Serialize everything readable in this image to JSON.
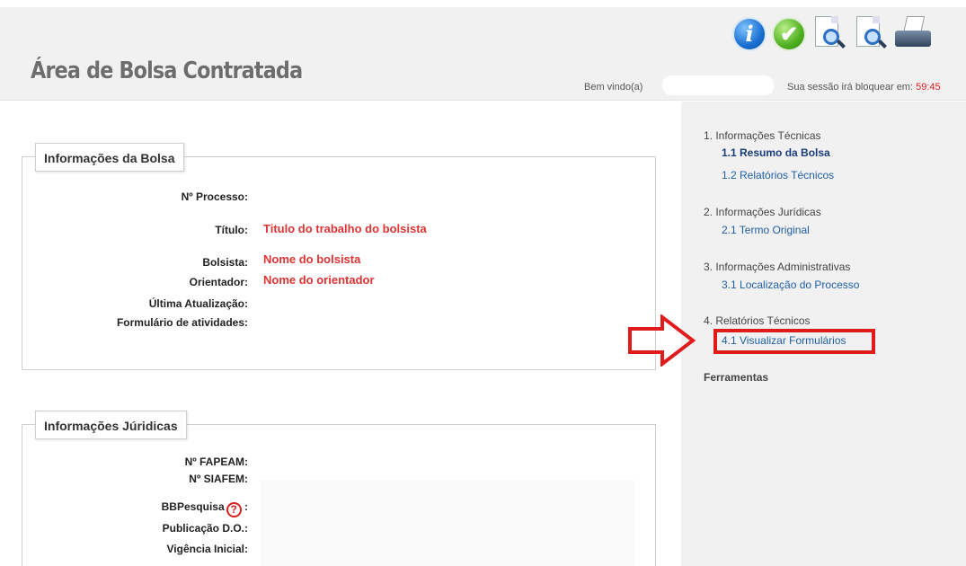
{
  "header": {
    "title": "Área de Bolsa Contratada",
    "welcome": "Bem vindo(a)",
    "session_label": "Sua sessão irá bloquear em:",
    "session_time": "59:45",
    "toolbar": [
      {
        "icon": "info-icon",
        "glyph": "i"
      },
      {
        "icon": "check-icon",
        "glyph": "✔"
      },
      {
        "icon": "document-search-icon"
      },
      {
        "icon": "document-zoom-icon"
      },
      {
        "icon": "printer-icon"
      }
    ]
  },
  "bolsa": {
    "legend": "Informações da Bolsa",
    "processo_label": "Nº Processo:",
    "titulo_label": "Título:",
    "titulo_value": "Titulo do trabalho do bolsista",
    "bolsista_label": "Bolsista:",
    "bolsista_value": "Nome do bolsista",
    "orientador_label": "Orientador:",
    "orientador_value": "Nome do orientador",
    "atualizacao_label": "Última Atualização:",
    "formulario_label": "Formulário de atividades:"
  },
  "juridicas": {
    "legend": "Informações Júridicas",
    "fapeam_label": "Nº FAPEAM:",
    "siafem_label": "Nº SIAFEM:",
    "bbpesquisa_label": "BBPesquisa",
    "bbpesquisa_colon": ":",
    "publicacao_label": "Publicação D.O.:",
    "vigencia_label": "Vigência Inicial:"
  },
  "sidebar": {
    "group1": "1. Informações Técnicas",
    "link1_1": "1.1 Resumo da Bolsa",
    "link1_2": "1.2 Relatórios Técnicos",
    "group2": "2. Informações Jurídicas",
    "link2_1": "2.1 Termo Original",
    "group3": "3. Informações Administrativas",
    "link3_1": "3.1 Localização do Processo",
    "group4": "4. Relatórios Técnicos",
    "link4_1": "4.1 Visualizar Formulários",
    "tools": "Ferramentas"
  },
  "colors": {
    "annotation_red": "#e01b1b",
    "link_blue": "#1f5fa8",
    "value_red": "#e03333"
  }
}
